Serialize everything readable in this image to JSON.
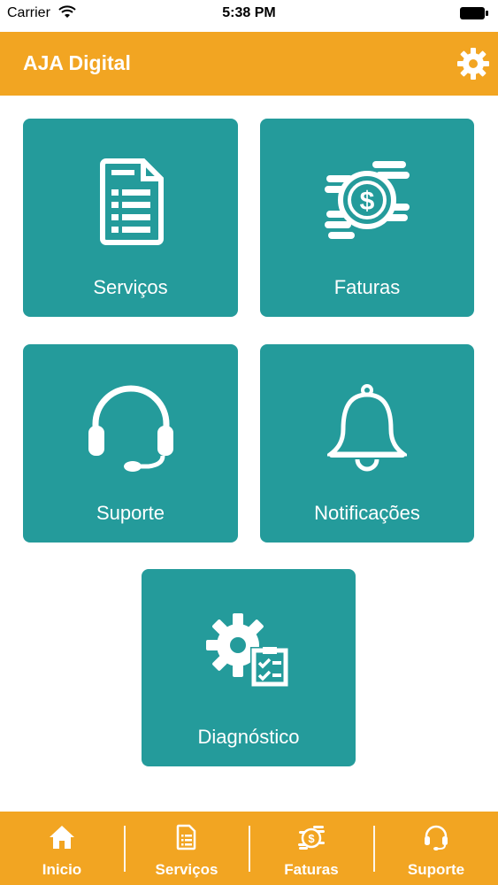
{
  "status_bar": {
    "carrier": "Carrier",
    "time": "5:38 PM"
  },
  "header": {
    "title": "AJA Digital",
    "settings_icon": "gear-icon"
  },
  "tiles": [
    {
      "label": "Serviços",
      "icon": "document-list-icon"
    },
    {
      "label": "Faturas",
      "icon": "coins-dollar-icon"
    },
    {
      "label": "Suporte",
      "icon": "headset-icon"
    },
    {
      "label": "Notificações",
      "icon": "bell-icon"
    },
    {
      "label": "Diagnóstico",
      "icon": "gear-checklist-icon"
    }
  ],
  "tab_bar": {
    "items": [
      {
        "label": "Inicio",
        "icon": "home-icon"
      },
      {
        "label": "Serviços",
        "icon": "document-icon"
      },
      {
        "label": "Faturas",
        "icon": "coins-icon"
      },
      {
        "label": "Suporte",
        "icon": "headset-icon"
      }
    ]
  },
  "colors": {
    "accent": "#f2a522",
    "tile": "#249b9b",
    "text_on_color": "#ffffff"
  }
}
